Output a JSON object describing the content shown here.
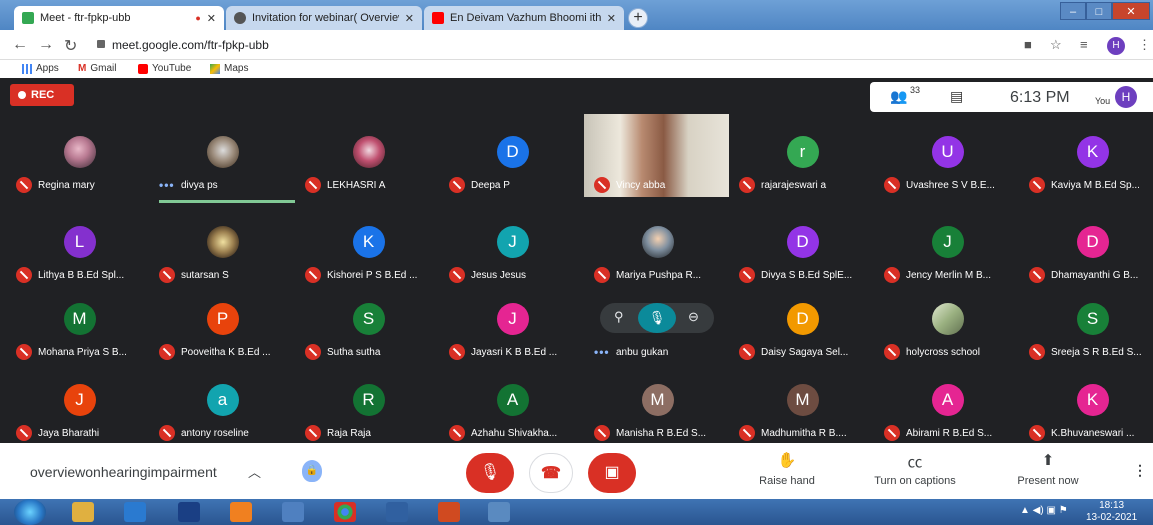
{
  "browser": {
    "tabs": [
      {
        "title": "Meet - ftr-fpkp-ubb",
        "fav_color": "#34a853",
        "active": true
      },
      {
        "title": "Invitation for webinar( Overview",
        "fav_color": "#444444",
        "active": false
      },
      {
        "title": "En Deivam Vazhum Bhoomi ithu",
        "fav_color": "#ff0000",
        "active": false
      }
    ],
    "url": "meet.google.com/ftr-fpkp-ubb",
    "bookmarks": [
      "Apps",
      "Gmail",
      "YouTube",
      "Maps"
    ],
    "profile_initial": "H"
  },
  "meet": {
    "rec_label": "REC",
    "participant_count": "33",
    "time": "6:13 PM",
    "you_label": "You",
    "you_initial": "H",
    "participants": [
      {
        "name": "Regina mary",
        "initial": "",
        "color": "",
        "photo": "photo",
        "status": "muted"
      },
      {
        "name": "divya ps",
        "initial": "",
        "color": "",
        "photo": "photo2",
        "status": "speaking"
      },
      {
        "name": "LEKHASRI A",
        "initial": "",
        "color": "",
        "photo": "photo3",
        "status": "muted"
      },
      {
        "name": "Deepa P",
        "initial": "D",
        "color": "#1a73e8",
        "photo": "",
        "status": "muted"
      },
      {
        "name": "Vincy abba",
        "initial": "",
        "color": "",
        "photo": "video",
        "status": "muted"
      },
      {
        "name": "rajarajeswari a",
        "initial": "r",
        "color": "#34a853",
        "photo": "",
        "status": "muted"
      },
      {
        "name": "Uvashree S V B.E...",
        "initial": "U",
        "color": "#9334e6",
        "photo": "",
        "status": "muted"
      },
      {
        "name": "Kaviya M B.Ed Sp...",
        "initial": "K",
        "color": "#9334e6",
        "photo": "",
        "status": "muted"
      },
      {
        "name": "Lithya B B.Ed Spl...",
        "initial": "L",
        "color": "#8430ce",
        "photo": "",
        "status": "muted"
      },
      {
        "name": "sutarsan S",
        "initial": "",
        "color": "",
        "photo": "photo4",
        "status": "muted"
      },
      {
        "name": "Kishorei P S B.Ed ...",
        "initial": "K",
        "color": "#1a73e8",
        "photo": "",
        "status": "muted"
      },
      {
        "name": "Jesus Jesus",
        "initial": "J",
        "color": "#12a4af",
        "photo": "",
        "status": "muted"
      },
      {
        "name": "Mariya Pushpa R...",
        "initial": "",
        "color": "",
        "photo": "photo5",
        "status": "muted"
      },
      {
        "name": "Divya S B.Ed SplE...",
        "initial": "D",
        "color": "#9334e6",
        "photo": "",
        "status": "muted"
      },
      {
        "name": "Jency Merlin M B...",
        "initial": "J",
        "color": "#188038",
        "photo": "",
        "status": "muted"
      },
      {
        "name": "Dhamayanthi G B...",
        "initial": "D",
        "color": "#e52592",
        "photo": "",
        "status": "muted"
      },
      {
        "name": "Mohana Priya S B...",
        "initial": "M",
        "color": "#137333",
        "photo": "",
        "status": "muted"
      },
      {
        "name": "Pooveitha K B.Ed ...",
        "initial": "P",
        "color": "#e8430c",
        "photo": "",
        "status": "muted"
      },
      {
        "name": "Sutha sutha",
        "initial": "S",
        "color": "#188038",
        "photo": "",
        "status": "muted"
      },
      {
        "name": "Jayasri K B B.Ed ...",
        "initial": "J",
        "color": "#e52592",
        "photo": "",
        "status": "muted"
      },
      {
        "name": "anbu gukan",
        "initial": "",
        "color": "",
        "photo": "",
        "status": "speaking-dots"
      },
      {
        "name": "Daisy Sagaya Sel...",
        "initial": "D",
        "color": "#f29900",
        "photo": "",
        "status": "muted"
      },
      {
        "name": "holycross school",
        "initial": "",
        "color": "",
        "photo": "photo6",
        "status": "muted"
      },
      {
        "name": "Sreeja S R B.Ed S...",
        "initial": "S",
        "color": "#188038",
        "photo": "",
        "status": "muted"
      },
      {
        "name": "Jaya Bharathi",
        "initial": "J",
        "color": "#e8430c",
        "photo": "",
        "status": "muted"
      },
      {
        "name": "antony roseline",
        "initial": "a",
        "color": "#12a4af",
        "photo": "",
        "status": "muted"
      },
      {
        "name": "Raja Raja",
        "initial": "R",
        "color": "#137333",
        "photo": "",
        "status": "muted"
      },
      {
        "name": "Azhahu Shivakha...",
        "initial": "A",
        "color": "#137333",
        "photo": "",
        "status": "muted"
      },
      {
        "name": "Manisha R B.Ed S...",
        "initial": "M",
        "color": "#8d6e63",
        "photo": "",
        "status": "muted"
      },
      {
        "name": "Madhumitha R B....",
        "initial": "M",
        "color": "#6d4c41",
        "photo": "",
        "status": "muted"
      },
      {
        "name": "Abirami R B.Ed S...",
        "initial": "A",
        "color": "#e52592",
        "photo": "",
        "status": "muted"
      },
      {
        "name": "K.Bhuvaneswari ...",
        "initial": "K",
        "color": "#e52592",
        "photo": "",
        "status": "muted"
      }
    ]
  },
  "bottom": {
    "meeting_name": "overviewonhearingimpairment",
    "raise_hand": "Raise hand",
    "captions": "Turn on captions",
    "present": "Present now"
  },
  "taskbar": {
    "time": "18:13",
    "date": "13-02-2021"
  }
}
